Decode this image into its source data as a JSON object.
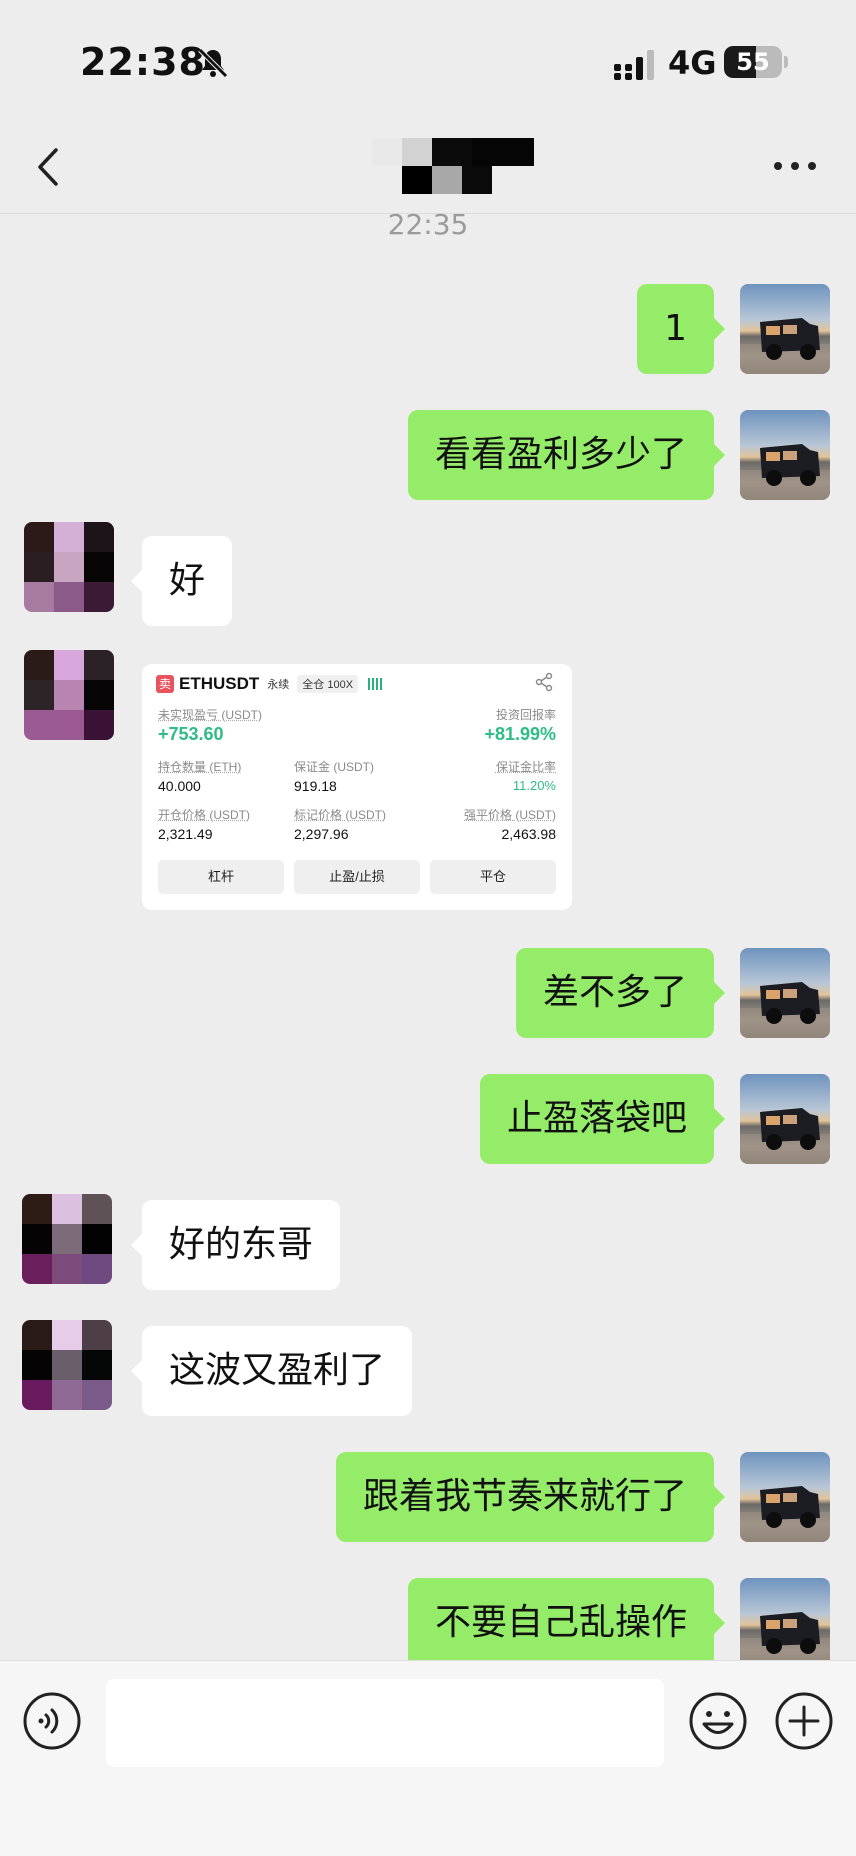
{
  "status_bar": {
    "time": "22:38",
    "network": "4G",
    "battery_percent": 55,
    "battery_label": "55",
    "icons": [
      "bell-slash-icon",
      "signal-icon"
    ]
  },
  "nav": {
    "title_redacted": true,
    "icons": [
      "chevron-left-icon",
      "more-icon"
    ]
  },
  "chat": {
    "timestamp": "22:35",
    "messages": [
      {
        "sender": "me",
        "text": "1"
      },
      {
        "sender": "me",
        "text": "看看盈利多少了"
      },
      {
        "sender": "them",
        "text": "好"
      },
      {
        "sender": "them",
        "type": "trade-card"
      },
      {
        "sender": "me",
        "text": "差不多了"
      },
      {
        "sender": "me",
        "text": "止盈落袋吧"
      },
      {
        "sender": "them",
        "text": "好的东哥"
      },
      {
        "sender": "them",
        "text": "这波又盈利了"
      },
      {
        "sender": "me",
        "text": "跟着我节奏来就行了"
      },
      {
        "sender": "me",
        "text": "不要自己乱操作"
      }
    ]
  },
  "trade_card": {
    "side_tag": "卖",
    "pair": "ETHUSDT",
    "contract_type": "永续",
    "margin_mode": "全仓 100X",
    "unrealized_pnl_label": "未实现盈亏 (USDT)",
    "unrealized_pnl": "+753.60",
    "roi_label": "投资回报率",
    "roi": "+81.99%",
    "position_size_label": "持仓数量 (ETH)",
    "position_size": "40.000",
    "margin_label": "保证金 (USDT)",
    "margin": "919.18",
    "margin_ratio_label": "保证金比率",
    "margin_ratio": "11.20%",
    "entry_price_label": "开仓价格 (USDT)",
    "entry_price": "2,321.49",
    "mark_price_label": "标记价格 (USDT)",
    "mark_price": "2,297.96",
    "liq_price_label": "强平价格 (USDT)",
    "liq_price": "2,463.98",
    "buttons": [
      "杠杆",
      "止盈/止损",
      "平仓"
    ],
    "colors": {
      "profit": "#2ebd85",
      "sell_tag": "#e8545d"
    }
  },
  "input_bar": {
    "placeholder": "",
    "icons": [
      "voice-icon",
      "emoji-icon",
      "plus-icon"
    ]
  },
  "colors": {
    "background": "#ededed",
    "my_bubble": "#95ec69",
    "their_bubble": "#ffffff"
  }
}
